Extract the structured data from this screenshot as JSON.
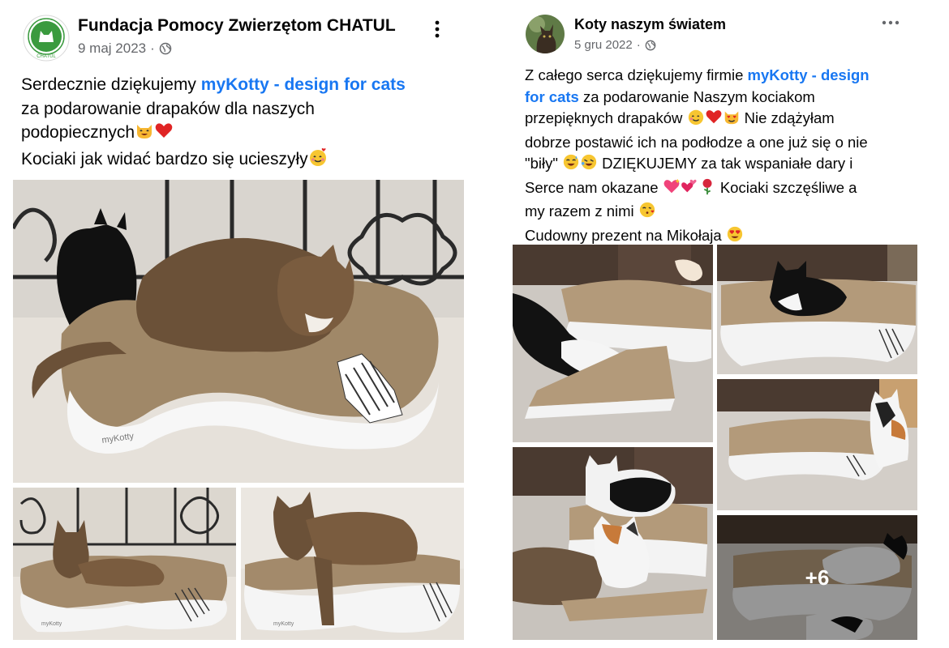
{
  "left_post": {
    "author": "Fundacja Pomocy Zwierzętom CHATUL",
    "date": "9 maj 2023",
    "privacy_icon": "globe-icon",
    "menu_icon": "vertical-dots-icon",
    "avatar_logo": "CHATUL",
    "text": {
      "line1_before": "Serdecznie dziękujemy ",
      "line1_link": "myKotty - design for cats",
      "line2": "za podarowanie drapaków dla naszych",
      "line3": "podopiecznych",
      "line4": "Kociaki jak widać bardzo się ucieszyły"
    },
    "photos": [
      {
        "label": "myKotty",
        "description": "cat on scratcher main"
      },
      {
        "label": "myKotty",
        "description": "tabby cat on scratcher"
      },
      {
        "label": "myKotty",
        "description": "tabby cat leaning off scratcher"
      }
    ]
  },
  "right_post": {
    "author": "Koty naszym światem",
    "date": "5 gru 2022",
    "privacy_icon": "globe-icon",
    "menu_icon": "horizontal-dots-icon",
    "text": {
      "line1_before": "Z całego serca dziękujemy firmie ",
      "line1_link": "myKotty - design",
      "line2_link": "for cats",
      "line2_after": " za podarowanie Naszym kociakom",
      "line3": "przepięknych drapaków ",
      "line3_after": " Nie zdążyłam",
      "line4": "dobrze postawić ich na podłodze a one już się o nie",
      "line5_before": "\"biły\" ",
      "line5_after": " DZIĘKUJEMY za tak wspaniałe dary i",
      "line6_before": "Serce nam okazane ",
      "line6_after": " Kociaki szczęśliwe a",
      "line7": "my razem z nimi ",
      "line8": "Cudowny prezent na Mikołaja "
    },
    "more_photos_count": "+6"
  },
  "colors": {
    "link": "#1877f2",
    "meta": "#65676b",
    "text": "#050505",
    "logo_green": "#3a9a3e"
  }
}
